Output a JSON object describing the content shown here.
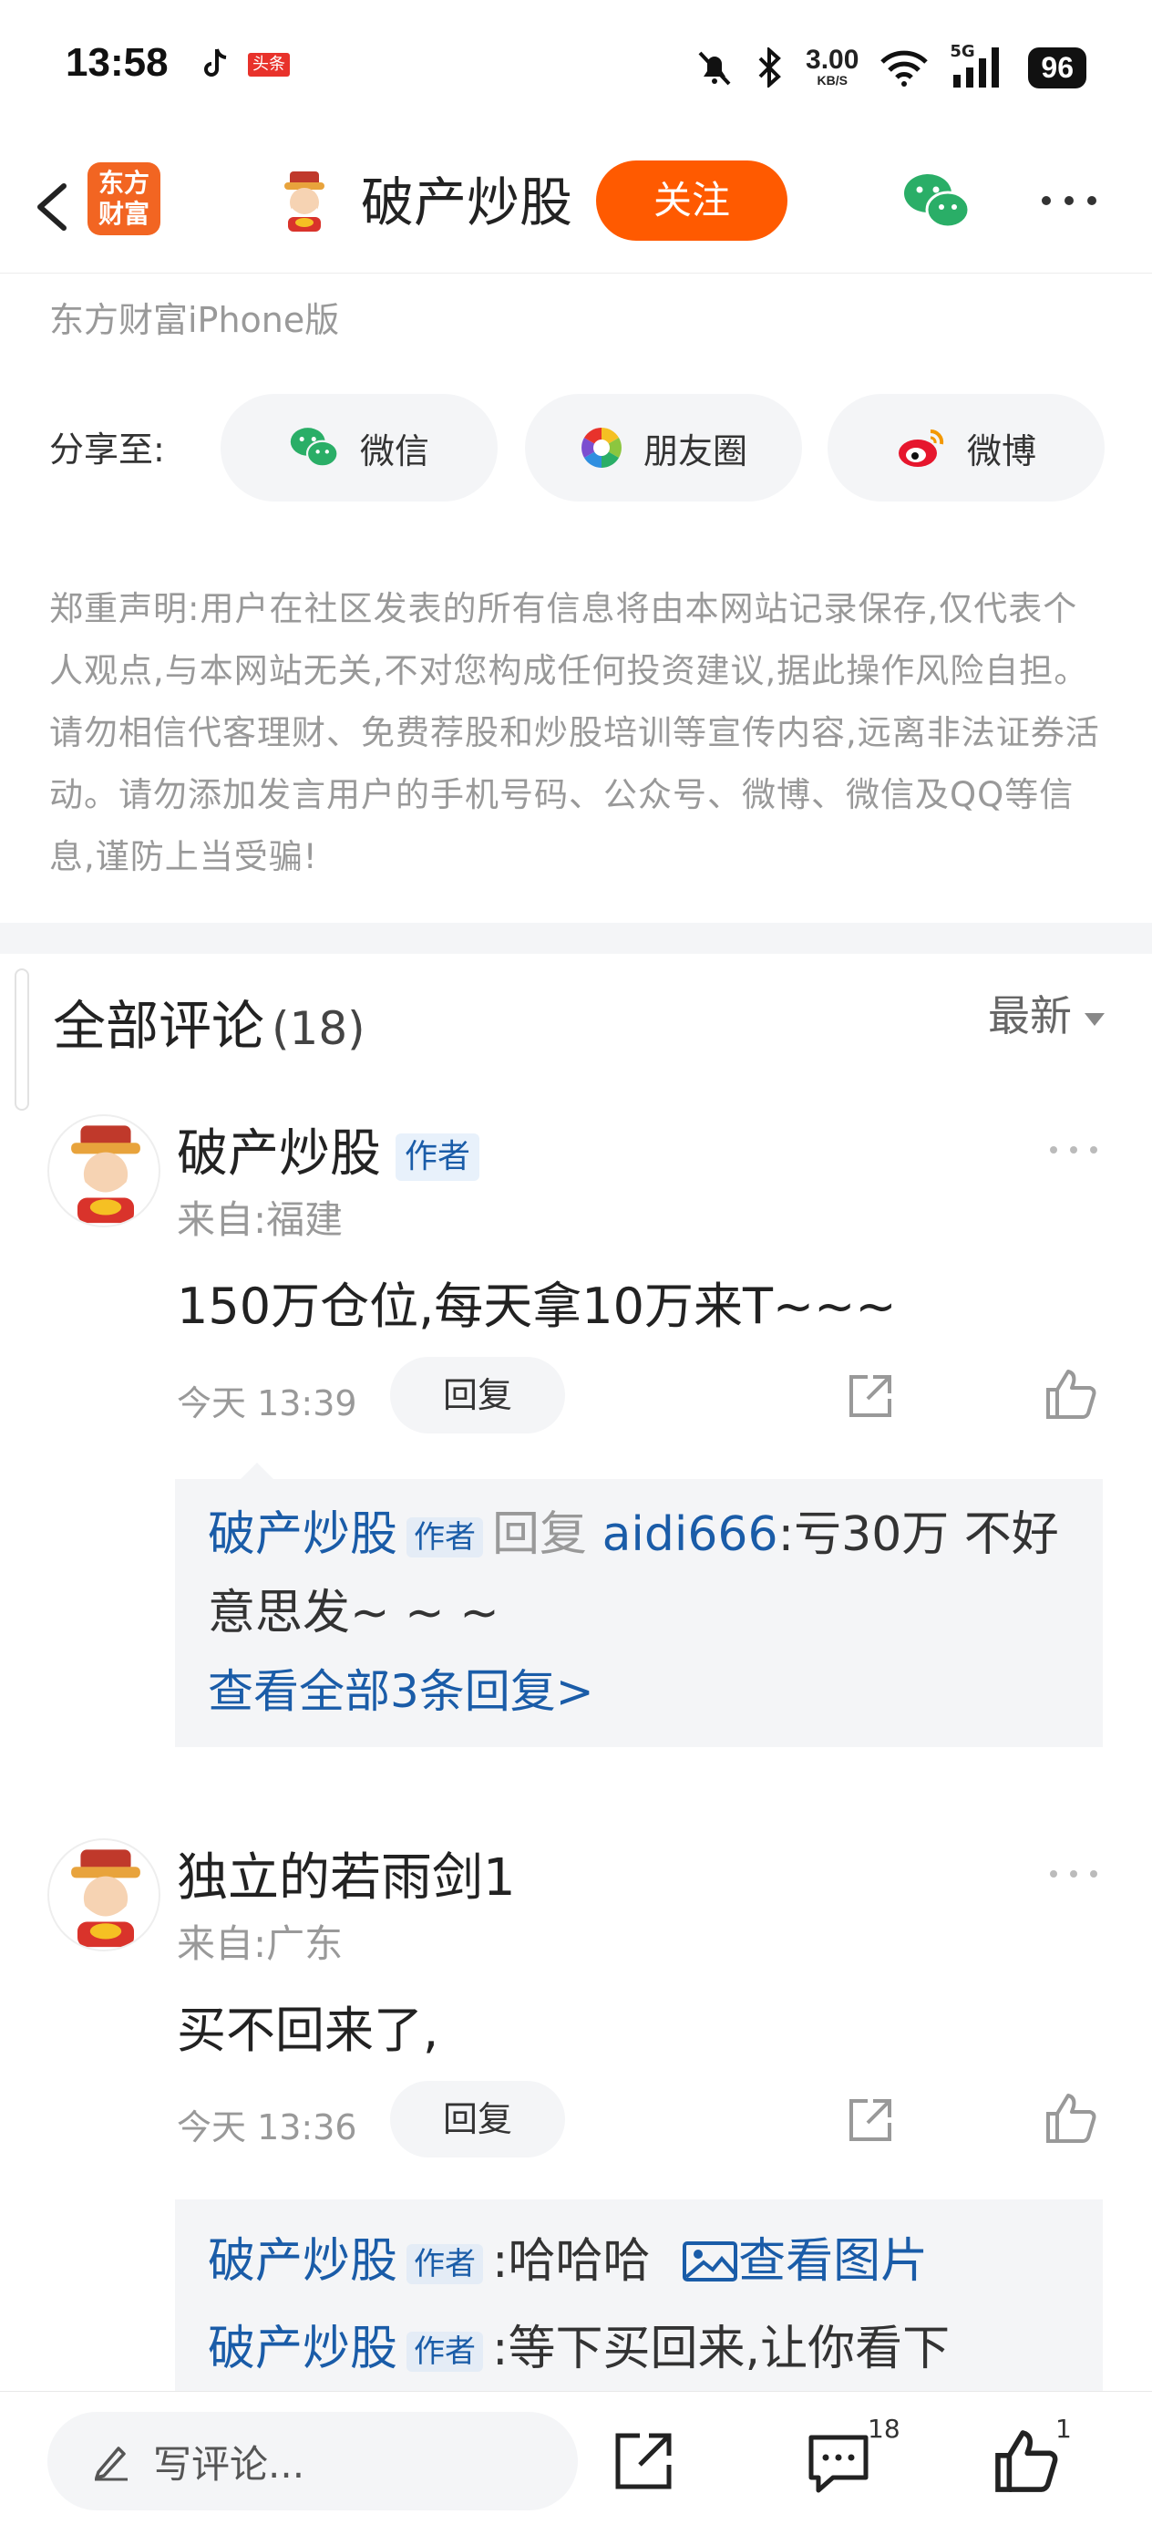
{
  "status_bar": {
    "time": "13:58",
    "toutiao_label": "头条",
    "net_speed_value": "3.00",
    "net_speed_unit": "KB/S",
    "signal_label": "5G",
    "battery": "96"
  },
  "header": {
    "logo_line1": "东方",
    "logo_line2": "财富",
    "title": "破产炒股",
    "follow_label": "关注"
  },
  "source_text": "东方财富iPhone版",
  "share": {
    "label": "分享至:",
    "items": [
      {
        "label": "微信",
        "icon": "wechat-icon"
      },
      {
        "label": "朋友圈",
        "icon": "moments-icon"
      },
      {
        "label": "微博",
        "icon": "weibo-icon"
      }
    ]
  },
  "disclaimer": "郑重声明:用户在社区发表的所有信息将由本网站记录保存,仅代表个人观点,与本网站无关,不对您构成任何投资建议,据此操作风险自担。请勿相信代客理财、免费荐股和炒股培训等宣传内容,远离非法证券活动。请勿添加发言用户的手机号码、公众号、微博、微信及QQ等信息,谨防上当受骗!",
  "comments_header": {
    "title": "全部评论",
    "count": "(18)",
    "sort_label": "最新"
  },
  "comments": [
    {
      "name": "破产炒股",
      "author_tag": "作者",
      "location": "来自:福建",
      "text": "150万仓位,每天拿10万来T~~~",
      "time": "今天 13:39",
      "reply_label": "回复",
      "replies": [
        {
          "name": "破产炒股",
          "tag": "作者",
          "reply_word": "回复",
          "target": "aidi666",
          "text": ":亏30万 不好意思发~ ~ ~"
        }
      ],
      "view_all": "查看全部3条回复>"
    },
    {
      "name": "独立的若雨剑1",
      "location": "来自:广东",
      "text": "买不回来了,",
      "time": "今天 13:36",
      "reply_label": "回复",
      "replies": [
        {
          "name": "破产炒股",
          "tag": "作者",
          "text": ":哈哈哈",
          "image_link": "查看图片"
        },
        {
          "name": "破产炒股",
          "tag": "作者",
          "text": ":等下买回来,让你看下"
        }
      ]
    }
  ],
  "bottom_bar": {
    "write_placeholder": "写评论...",
    "comment_count": "18",
    "like_count": "1"
  },
  "colors": {
    "accent_orange": "#ff5a00",
    "link_blue": "#1a5ca8",
    "wechat_green": "#2aae67"
  }
}
